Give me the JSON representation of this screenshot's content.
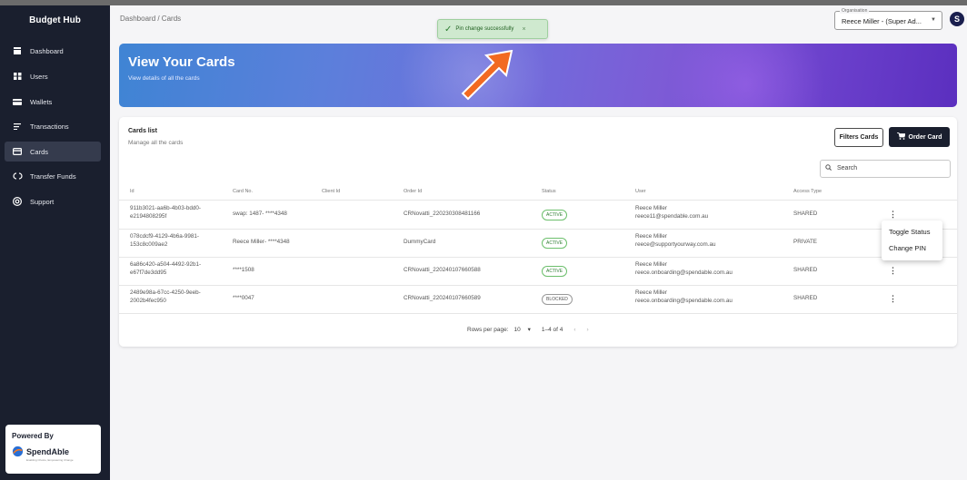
{
  "sidebar": {
    "brand": "Budget Hub",
    "items": [
      {
        "label": "Dashboard",
        "icon": "dashboard-icon"
      },
      {
        "label": "Users",
        "icon": "users-icon"
      },
      {
        "label": "Wallets",
        "icon": "wallet-icon"
      },
      {
        "label": "Transactions",
        "icon": "transactions-icon"
      },
      {
        "label": "Cards",
        "icon": "card-icon",
        "active": true
      },
      {
        "label": "Transfer Funds",
        "icon": "transfer-icon"
      },
      {
        "label": "Support",
        "icon": "support-icon"
      }
    ],
    "powered_by": "Powered By",
    "logo_text": "SpendAble",
    "logo_tagline": "Enabling Choice, Empowering Change"
  },
  "header": {
    "breadcrumb": "Dashboard / Cards",
    "organisation_label": "Organisation",
    "organisation_value": "Reece Miller - (Super Ad...",
    "avatar_initial": "S"
  },
  "toast": {
    "message": "Pin change successfully",
    "close": "×"
  },
  "banner": {
    "title": "View Your Cards",
    "subtitle": "View details of all the cards"
  },
  "cards_list": {
    "title": "Cards list",
    "subtitle": "Manage all the cards",
    "filter_button": "Filters Cards",
    "order_button": "Order Card",
    "search_placeholder": "Search",
    "columns": [
      "Id",
      "Card No.",
      "Client Id",
      "Order Id",
      "Status",
      "User",
      "Access Type"
    ],
    "rows": [
      {
        "id_line1": "911b3021-aa6b-4b03-bdd0-",
        "id_line2": "e2194808295f",
        "card_no": "swap: 1487- ****4348",
        "client_id": "",
        "order_id": "CRNovatti_220230308481166",
        "status": "ACTIVE",
        "user_name": "Reece Miller",
        "user_email": "reece11@spendable.com.au",
        "access": "SHARED"
      },
      {
        "id_line1": "078cdcf9-4129-4b6a-9981-",
        "id_line2": "153c8c009ae2",
        "card_no": "Reece Miller- ****4348",
        "client_id": "",
        "order_id": "DummyCard",
        "status": "ACTIVE",
        "user_name": "Reece Miller",
        "user_email": "reece@supportyourway.com.au",
        "access": "PRIVATE"
      },
      {
        "id_line1": "6a86c420-a504-4492-92b1-",
        "id_line2": "e67f7de3dd95",
        "card_no": "****1508",
        "client_id": "",
        "order_id": "CRNovatti_220240107660588",
        "status": "ACTIVE",
        "user_name": "Reece Miller",
        "user_email": "reece.onboarding@spendable.com.au",
        "access": "SHARED"
      },
      {
        "id_line1": "2489e98a-67cc-4250-9eeb-",
        "id_line2": "2002b4fec950",
        "card_no": "****0047",
        "client_id": "",
        "order_id": "CRNovatti_220240107660589",
        "status": "BLOCKED",
        "user_name": "Reece Miller",
        "user_email": "reece.onboarding@spendable.com.au",
        "access": "SHARED"
      }
    ],
    "rows_per_page_label": "Rows per page:",
    "rows_per_page_value": "10",
    "range": "1–4 of 4",
    "prev": "‹",
    "next": "›"
  },
  "context_menu": {
    "items": [
      "Toggle Status",
      "Change PIN"
    ]
  },
  "colors": {
    "sidebar_bg": "#1a1f2e",
    "active_green": "#2e7d32",
    "toast_bg": "#cfe9cf",
    "arrow": "#f26a21"
  }
}
